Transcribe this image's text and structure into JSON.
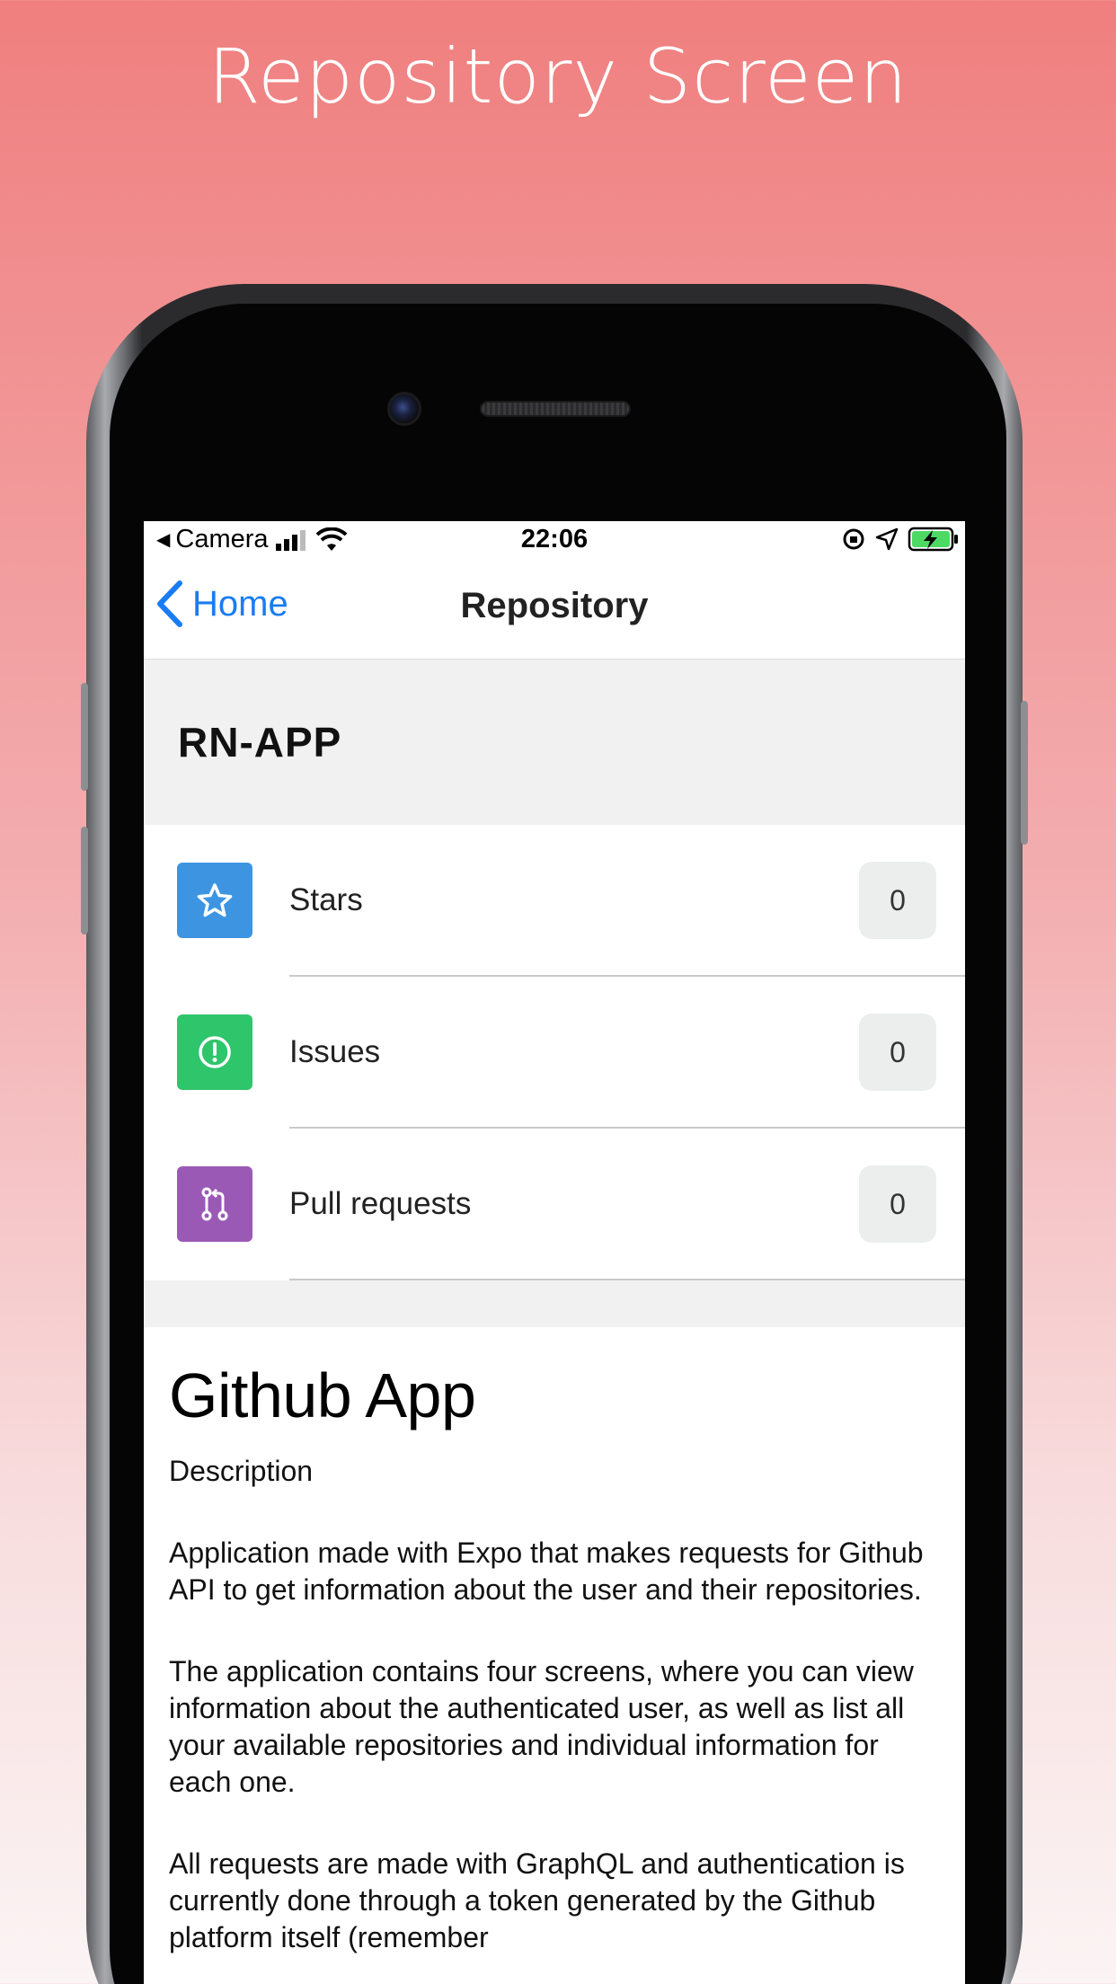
{
  "headline": "Repository Screen",
  "status_bar": {
    "back_app": "Camera",
    "time": "22:06"
  },
  "nav": {
    "back_label": "Home",
    "title": "Repository"
  },
  "repo": {
    "name": "RN-APP",
    "stats": [
      {
        "label": "Stars",
        "count": "0",
        "color": "#3d95e2",
        "icon": "star-icon"
      },
      {
        "label": "Issues",
        "count": "0",
        "color": "#2fc56b",
        "icon": "alert-circle-icon"
      },
      {
        "label": "Pull requests",
        "count": "0",
        "color": "#9b59b6",
        "icon": "pull-request-icon"
      }
    ]
  },
  "readme": {
    "title": "Github App",
    "description_label": "Description",
    "paragraphs": [
      "Application made with Expo that makes requests for Github API to get information about the user and their repositories.",
      "The application contains four screens, where you can view information about the authenticated user, as well as list all your available repositories and individual information for each one.",
      "All requests are made with GraphQL and authentication is currently done through a token generated by the Github platform itself (remember"
    ]
  }
}
